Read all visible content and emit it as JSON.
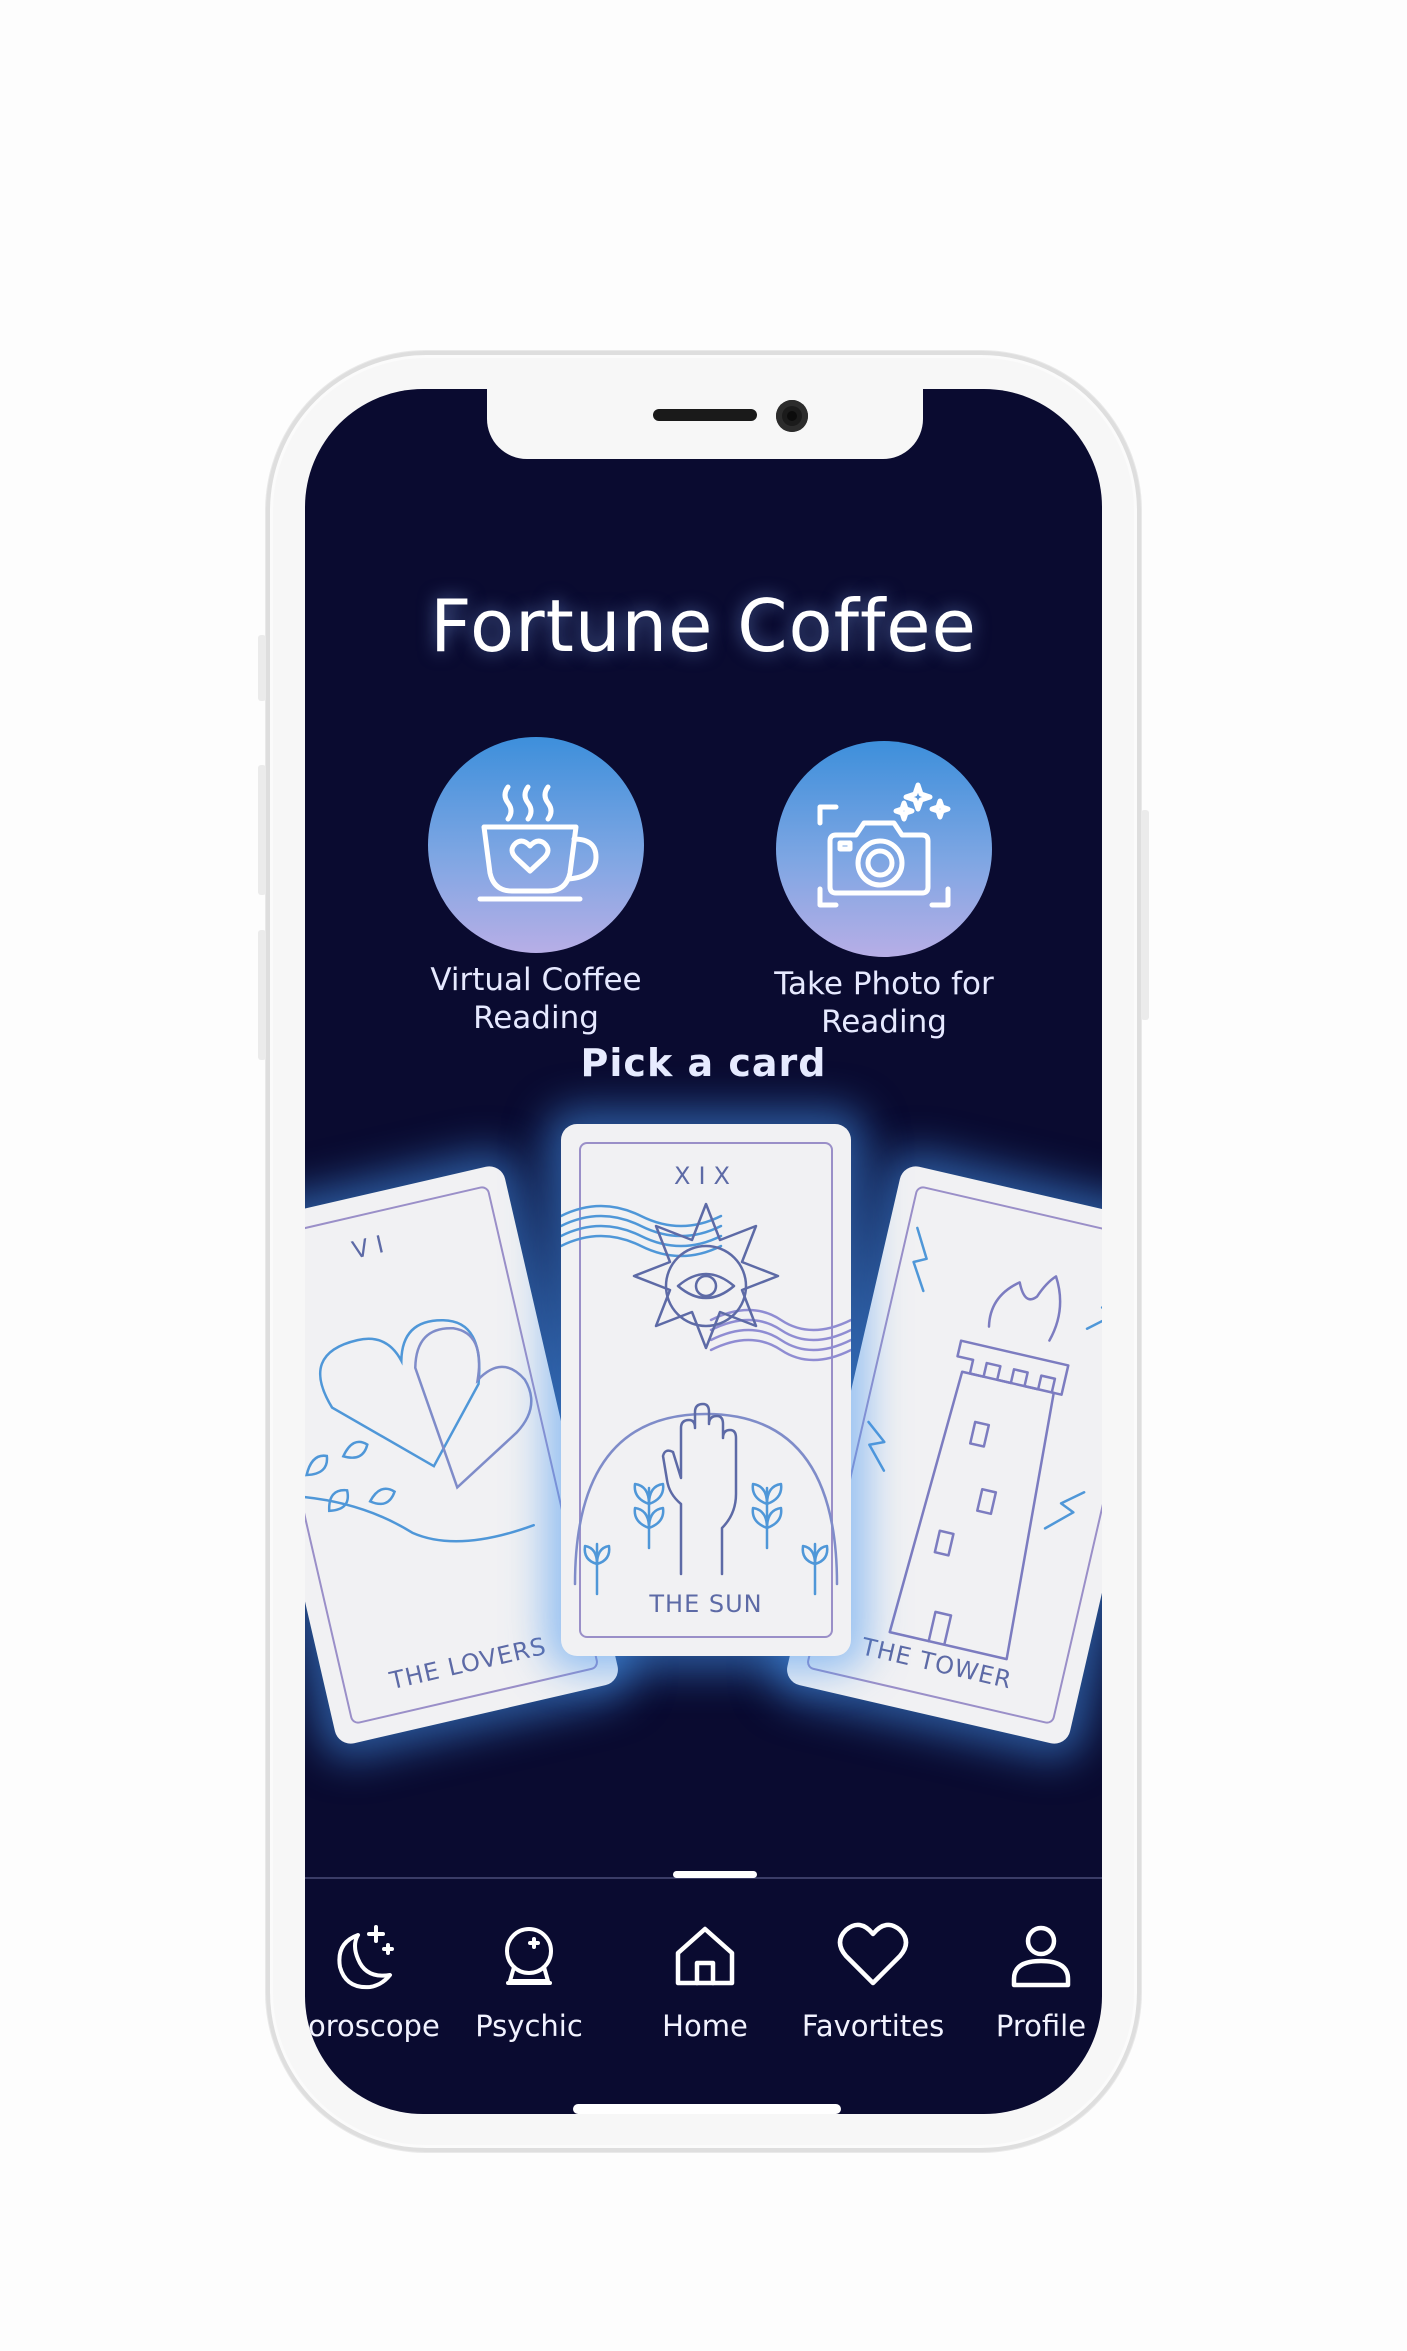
{
  "app": {
    "title": "Fortune Coffee"
  },
  "actions": [
    {
      "label": "Virtual Coffee Reading",
      "icon": "coffee-cup-heart-icon"
    },
    {
      "label": "Take Photo for Reading",
      "icon": "camera-sparkle-icon"
    }
  ],
  "section": {
    "pick_label": "Pick a card"
  },
  "cards": [
    {
      "numeral": "VI",
      "name": "THE LOVERS",
      "icon": "hearts-icon"
    },
    {
      "numeral": "XIX",
      "name": "THE SUN",
      "icon": "sun-eye-icon"
    },
    {
      "numeral": "",
      "name": "THE TOWER",
      "icon": "tower-icon"
    }
  ],
  "nav": {
    "items": [
      {
        "label": "Horoscope",
        "icon": "moon-stars-icon"
      },
      {
        "label": "Psychic",
        "icon": "crystal-ball-icon"
      },
      {
        "label": "Home",
        "icon": "home-icon",
        "active": true
      },
      {
        "label": "Favortites",
        "icon": "heart-icon"
      },
      {
        "label": "Profile",
        "icon": "user-icon"
      }
    ]
  },
  "colors": {
    "screen_background": "#0a0b30",
    "accent_glow": "#4696f0",
    "card_line": "#5d6aa6"
  }
}
